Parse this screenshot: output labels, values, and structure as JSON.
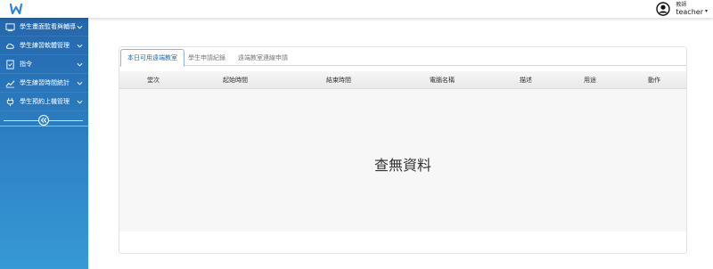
{
  "header": {
    "user_role": "教師",
    "user_name": "teacher"
  },
  "sidebar": {
    "items": [
      {
        "label": "學生畫面監看與輔導",
        "icon": "monitor-icon"
      },
      {
        "label": "學生練習軟體管理",
        "icon": "cloud-icon"
      },
      {
        "label": "指令",
        "icon": "command-icon"
      },
      {
        "label": "學生練習時間統計",
        "icon": "chart-icon"
      },
      {
        "label": "學生預約上機管理",
        "icon": "plug-icon"
      }
    ]
  },
  "main": {
    "tabs": [
      {
        "label": "本日可用遠端教室",
        "active": true
      },
      {
        "label": "學生申請紀錄",
        "active": false
      },
      {
        "label": "遠端教室連線申請",
        "active": false
      }
    ],
    "columns": [
      "堂次",
      "起始時間",
      "結束時間",
      "電腦名稱",
      "描述",
      "用途",
      "動作"
    ],
    "empty_text": "查無資料"
  },
  "colors": {
    "sidebar_top": "#2467ad",
    "sidebar_bottom": "#3799d6",
    "accent": "#2b6cb0"
  }
}
